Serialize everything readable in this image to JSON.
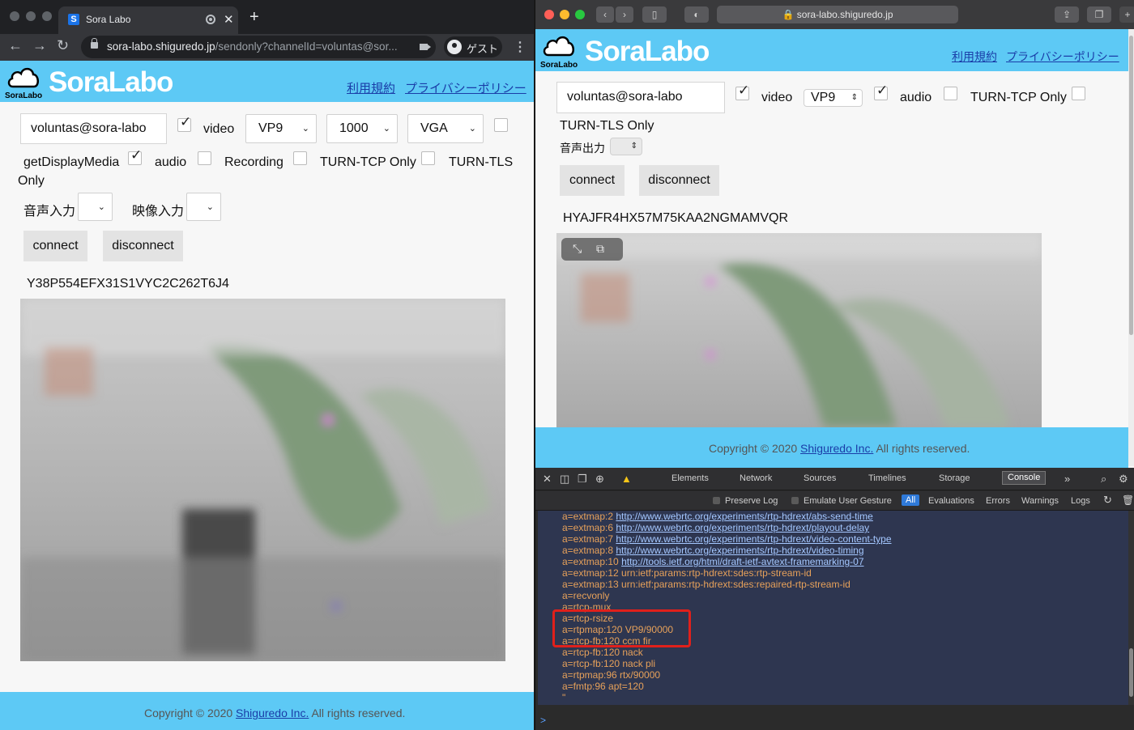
{
  "left": {
    "tab_title": "Sora Labo",
    "tab_favicon": "S",
    "url_host": "sora-labo.shiguredo.jp",
    "url_path": "/sendonly?channelId=voluntas@sor...",
    "guest_label": "ゲスト",
    "brand_small": "SoraLabo",
    "brand_big": "SoraLabo",
    "links": {
      "terms": "利用規約",
      "privacy": "プライバシーポリシー"
    },
    "channel_id": "voluntas@sora-labo",
    "video_label": "video",
    "video_codec": "VP9",
    "bitrate": "1000",
    "resolution": "VGA",
    "get_display_media_1": "getDisplayMedia",
    "get_display_media_2": "Only",
    "audio_label": "audio",
    "recording_label": "Recording",
    "turn_tcp_label": "TURN-TCP Only",
    "turn_tls_label": "TURN-TLS",
    "audio_input_label": "音声入力",
    "video_input_label": "映像入力",
    "connect_label": "connect",
    "disconnect_label": "disconnect",
    "connection_id": "Y38P554EFX31S1VYC2C262T6J4",
    "copyright_pre": "Copyright © 2020 ",
    "copyright_link": "Shiguredo Inc.",
    "copyright_post": " All rights reserved."
  },
  "right": {
    "address": "sora-labo.shiguredo.jp",
    "brand_small": "SoraLabo",
    "brand_big": "SoraLabo",
    "links": {
      "terms": "利用規約",
      "privacy": "プライバシーポリシー"
    },
    "channel_id": "voluntas@sora-labo",
    "video_label": "video",
    "video_codec": "VP9",
    "audio_label": "audio",
    "turn_tcp_label": "TURN-TCP Only",
    "turn_tls_label": "TURN-TLS Only",
    "audio_output_label": "音声出力",
    "connect_label": "connect",
    "disconnect_label": "disconnect",
    "connection_id": "HYAJFR4HX57M75KAA2NGMAMVQR",
    "copyright_pre": "Copyright © 2020 ",
    "copyright_link": "Shiguredo Inc.",
    "copyright_post": " All rights reserved."
  },
  "devtools": {
    "tabs": [
      "Elements",
      "Network",
      "Sources",
      "Timelines",
      "Storage",
      "Console"
    ],
    "filters": {
      "preserve_log": "Preserve Log",
      "emulate_gesture": "Emulate User Gesture",
      "all": "All",
      "evaluations": "Evaluations",
      "errors": "Errors",
      "warnings": "Warnings",
      "logs": "Logs"
    },
    "console_lines": [
      {
        "prefix": "a=extmap:2 ",
        "link": "http://www.webrtc.org/experiments/rtp-hdrext/abs-send-time"
      },
      {
        "prefix": "a=extmap:6 ",
        "link": "http://www.webrtc.org/experiments/rtp-hdrext/playout-delay"
      },
      {
        "prefix": "a=extmap:7 ",
        "link": "http://www.webrtc.org/experiments/rtp-hdrext/video-content-type"
      },
      {
        "prefix": "a=extmap:8 ",
        "link": "http://www.webrtc.org/experiments/rtp-hdrext/video-timing"
      },
      {
        "prefix": "a=extmap:10 ",
        "link": "http://tools.ietf.org/html/draft-ietf-avtext-framemarking-07"
      },
      {
        "prefix": "a=extmap:12 urn:ietf:params:rtp-hdrext:sdes:rtp-stream-id",
        "link": ""
      },
      {
        "prefix": "a=extmap:13 urn:ietf:params:rtp-hdrext:sdes:repaired-rtp-stream-id",
        "link": ""
      },
      {
        "prefix": "a=recvonly",
        "link": ""
      },
      {
        "prefix": "a=rtcp-mux",
        "link": ""
      },
      {
        "prefix": "a=rtcp-rsize",
        "link": ""
      },
      {
        "prefix": "a=rtpmap:120 VP9/90000",
        "link": ""
      },
      {
        "prefix": "a=rtcp-fb:120 ccm fir",
        "link": ""
      },
      {
        "prefix": "a=rtcp-fb:120 nack",
        "link": ""
      },
      {
        "prefix": "a=rtcp-fb:120 nack pli",
        "link": ""
      },
      {
        "prefix": "a=rtpmap:96 rtx/90000",
        "link": ""
      },
      {
        "prefix": "a=fmtp:96 apt=120",
        "link": ""
      },
      {
        "prefix": "\"",
        "link": ""
      }
    ],
    "prompt": ">"
  },
  "colors": {
    "brand": "#5dc9f5",
    "link": "#1a3da8",
    "highlight": "#e0201b"
  }
}
